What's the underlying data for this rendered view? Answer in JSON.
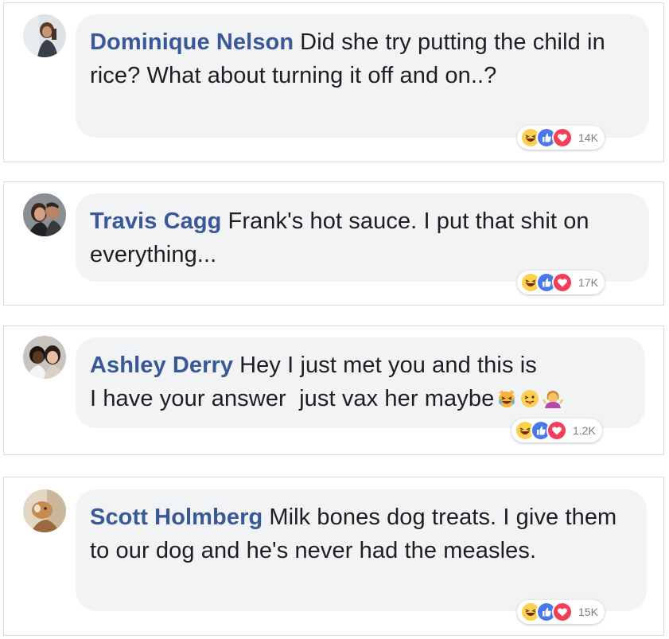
{
  "comments": [
    {
      "author": "Dominique Nelson",
      "text": "Did she try putting the child in rice? What about turning it off and on..?",
      "reaction_count": "14K",
      "reactions": [
        "haha-icon",
        "like-icon",
        "love-icon"
      ]
    },
    {
      "author": "Travis Cagg",
      "text": "Frank's hot sauce. I put that shit on everything...",
      "reaction_count": "17K",
      "reactions": [
        "haha-icon",
        "like-icon",
        "love-icon"
      ]
    },
    {
      "author": "Ashley Derry",
      "text_line1": "Hey I just met you and this is",
      "text_line2": "I have your answer  just vax her maybe",
      "inline_emojis": [
        "crying-laughing-cat-emoji",
        "tongue-face-emoji",
        "person-shrugging-emoji"
      ],
      "reaction_count": "1.2K",
      "reactions": [
        "haha-icon",
        "like-icon",
        "love-icon"
      ]
    },
    {
      "author": "Scott Holmberg",
      "text": "Milk bones dog treats. I give them to our dog and he's never had the measles.",
      "reaction_count": "15K",
      "reactions": [
        "haha-icon",
        "like-icon",
        "love-icon"
      ]
    }
  ],
  "colors": {
    "author": "#385898",
    "bubble": "#f2f3f5",
    "like": "#4a78e8",
    "love": "#f33e58",
    "haha": "#fcd050"
  }
}
